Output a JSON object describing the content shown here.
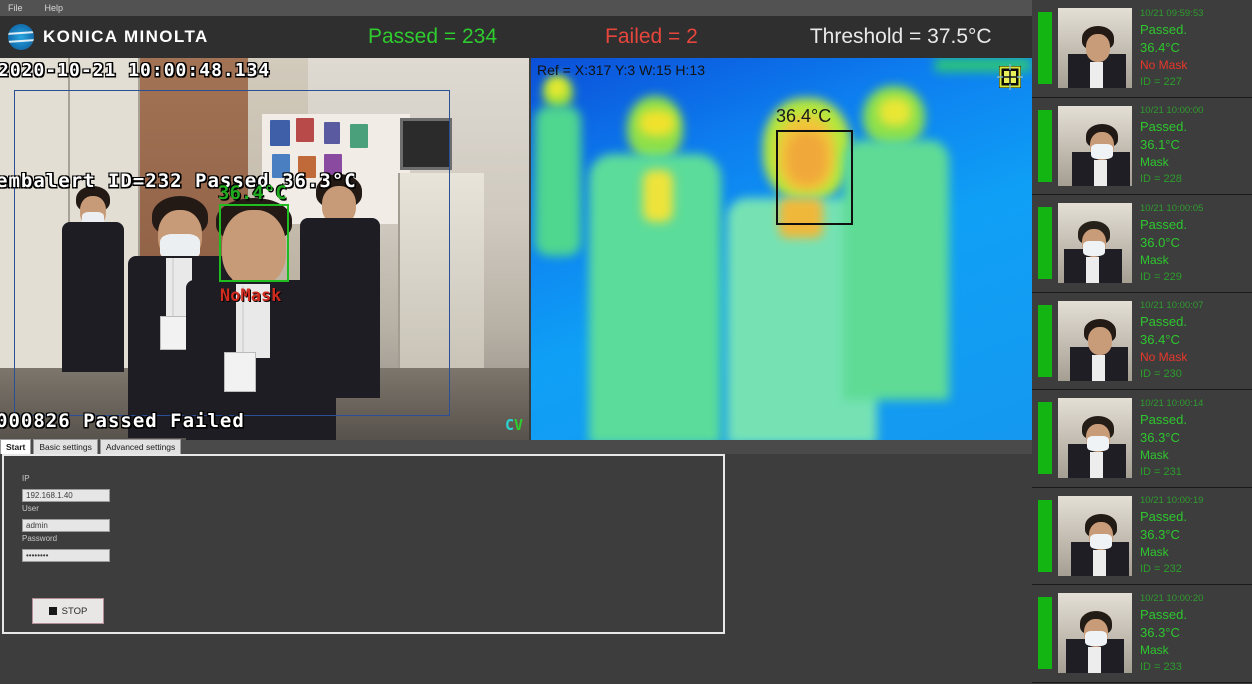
{
  "menubar": {
    "items": [
      {
        "label": "File"
      },
      {
        "label": "Help"
      }
    ]
  },
  "header": {
    "brand": "KONICA MINOLTA",
    "passed_label": "Passed = 234",
    "failed_label": "Failed = 2",
    "threshold_label": "Threshold = 37.5°C",
    "colors": {
      "passed": "#2ecc2e",
      "failed": "#e8463c",
      "threshold": "#e9e9e9"
    }
  },
  "rgb_panel": {
    "timestamp_overlay": "2020-10-21 10:00:48.134",
    "status_overlay": "embalert ID=232 Passed 36.3°C",
    "temp_overlay": "36.4°C",
    "bottom_overlay": "000826 Passed Failed",
    "face_label": "NoMask",
    "watermark": "CV"
  },
  "thermal_panel": {
    "ref_text": "Ref = X:317 Y:3 W:15 H:13",
    "temp_label": "36.4°C"
  },
  "tabs": [
    {
      "label": "Start",
      "active": true
    },
    {
      "label": "Basic settings",
      "active": false
    },
    {
      "label": "Advanced settings",
      "active": false
    }
  ],
  "settings": {
    "ip_label": "IP",
    "ip_value": "192.168.1.40",
    "user_label": "User",
    "user_value": "admin",
    "password_label": "Password",
    "password_value": "••••••••",
    "stop_label": "STOP"
  },
  "events": [
    {
      "time": "10/21 09:59:53",
      "result": "Passed.",
      "temp": "36.4°C",
      "mask": "No Mask",
      "mask_ok": false,
      "id": "ID = 227"
    },
    {
      "time": "10/21 10:00:00",
      "result": "Passed.",
      "temp": "36.1°C",
      "mask": "Mask",
      "mask_ok": true,
      "id": "ID = 228"
    },
    {
      "time": "10/21 10:00:05",
      "result": "Passed.",
      "temp": "36.0°C",
      "mask": "Mask",
      "mask_ok": true,
      "id": "ID = 229"
    },
    {
      "time": "10/21 10:00:07",
      "result": "Passed.",
      "temp": "36.4°C",
      "mask": "No Mask",
      "mask_ok": false,
      "id": "ID = 230"
    },
    {
      "time": "10/21 10:00:14",
      "result": "Passed.",
      "temp": "36.3°C",
      "mask": "Mask",
      "mask_ok": true,
      "id": "ID = 231"
    },
    {
      "time": "10/21 10:00:19",
      "result": "Passed.",
      "temp": "36.3°C",
      "mask": "Mask",
      "mask_ok": true,
      "id": "ID = 232"
    },
    {
      "time": "10/21 10:00:20",
      "result": "Passed.",
      "temp": "36.3°C",
      "mask": "Mask",
      "mask_ok": true,
      "id": "ID = 233"
    }
  ]
}
